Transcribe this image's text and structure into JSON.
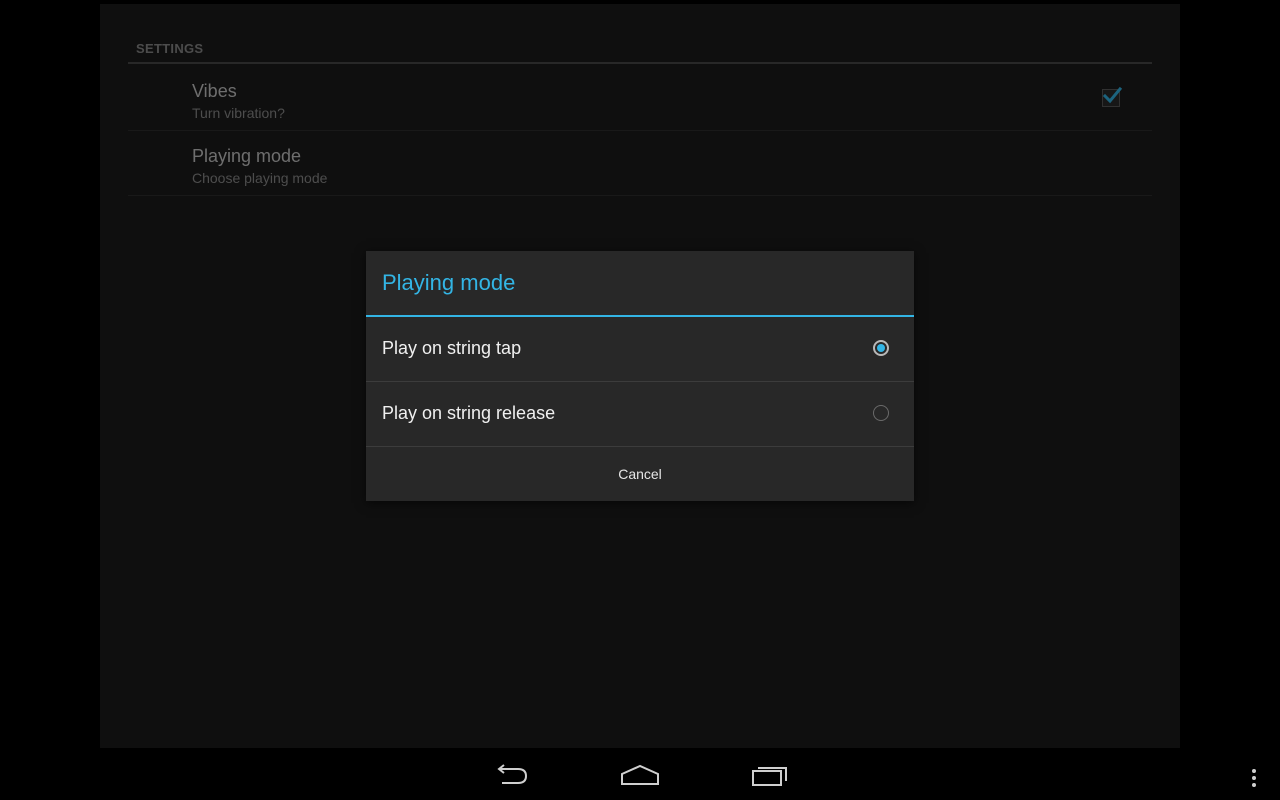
{
  "settings": {
    "section_header": "SETTINGS",
    "items": [
      {
        "title": "Vibes",
        "summary": "Turn vibration?",
        "checked": true
      },
      {
        "title": "Playing mode",
        "summary": "Choose playing mode"
      }
    ]
  },
  "dialog": {
    "title": "Playing mode",
    "options": [
      {
        "label": "Play on string tap",
        "selected": true
      },
      {
        "label": "Play on string release",
        "selected": false
      }
    ],
    "cancel_label": "Cancel"
  },
  "navbar": {
    "icons": [
      "back-icon",
      "home-icon",
      "recent-apps-icon",
      "overflow-menu-icon"
    ]
  },
  "colors": {
    "accent": "#33b5e5",
    "dialog_bg": "#282828",
    "panel_bg": "#1c1c1c"
  }
}
